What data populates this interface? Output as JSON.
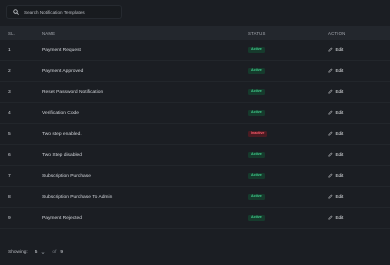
{
  "search": {
    "placeholder": "Search Notification Templates"
  },
  "table": {
    "headers": {
      "sl": "SL.",
      "name": "NAME",
      "status": "STATUS",
      "action": "ACTION"
    },
    "rows": [
      {
        "sl": "1",
        "name": "Payment Request",
        "status": "Active",
        "action": "Edit"
      },
      {
        "sl": "2",
        "name": "Payment Approved",
        "status": "Active",
        "action": "Edit"
      },
      {
        "sl": "3",
        "name": "Reset Password Notification",
        "status": "Active",
        "action": "Edit"
      },
      {
        "sl": "4",
        "name": "Verification Code",
        "status": "Active",
        "action": "Edit"
      },
      {
        "sl": "5",
        "name": "Two step enabled.",
        "status": "Inactive",
        "action": "Edit"
      },
      {
        "sl": "6",
        "name": "Two Step disabled",
        "status": "Active",
        "action": "Edit"
      },
      {
        "sl": "7",
        "name": "Subscription Purchase",
        "status": "Active",
        "action": "Edit"
      },
      {
        "sl": "8",
        "name": "Subscription Purchase To Admin",
        "status": "Active",
        "action": "Edit"
      },
      {
        "sl": "9",
        "name": "Payment Rejected",
        "status": "Active",
        "action": "Edit"
      }
    ]
  },
  "footer": {
    "showing_label": "Showing:",
    "page_size": "5",
    "of_label": "of",
    "total": "9"
  },
  "colors": {
    "background": "#1b1e23",
    "active": "#3fce8c",
    "inactive": "#ff5c6c"
  },
  "icons": {
    "search": "search-icon",
    "edit": "pencil-icon",
    "dropdown": "chevron-down-icon"
  }
}
